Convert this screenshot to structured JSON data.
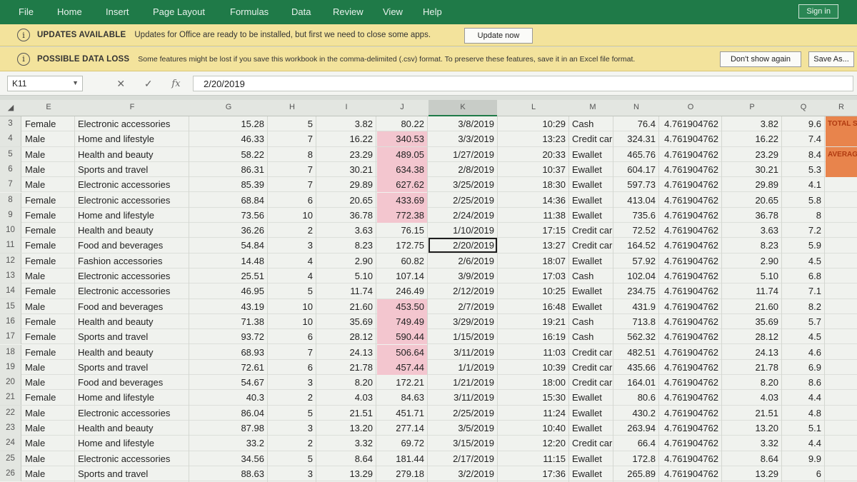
{
  "ribbon": {
    "tabs": [
      "File",
      "Home",
      "Insert",
      "Page Layout",
      "Formulas",
      "Data",
      "Review",
      "View",
      "Help"
    ],
    "signin_label": "Sign in"
  },
  "messages": {
    "updates_title": "UPDATES AVAILABLE",
    "updates_text": "Updates for Office are ready to be installed, but first we need to close some apps.",
    "update_now_label": "Update now",
    "dataloss_title": "POSSIBLE DATA LOSS",
    "dataloss_text": "Some features might be lost if you save this workbook in the comma-delimited (.csv) format. To preserve these features, save it in an Excel file format.",
    "dont_show_label": "Don't show again",
    "save_as_label": "Save As..."
  },
  "formula_bar": {
    "name_box": "K11",
    "value": "2/20/2019"
  },
  "columns": [
    "E",
    "F",
    "G",
    "H",
    "I",
    "J",
    "K",
    "L",
    "M",
    "N",
    "O",
    "P",
    "Q",
    "R"
  ],
  "rows": [
    {
      "n": "3",
      "e": "Female",
      "f": "Electronic accessories",
      "g": "15.28",
      "h": "5",
      "i": "3.82",
      "j": "80.22",
      "k": "3/8/2019",
      "l": "10:29",
      "m": "Cash",
      "nn": "76.4",
      "o": "4.761904762",
      "p": "3.82",
      "q": "9.6",
      "r": "TOTAL S"
    },
    {
      "n": "4",
      "e": "Male",
      "f": "Home and lifestyle",
      "g": "46.33",
      "h": "7",
      "i": "16.22",
      "j": "340.53",
      "k": "3/3/2019",
      "l": "13:23",
      "m": "Credit car",
      "nn": "324.31",
      "o": "4.761904762",
      "p": "16.22",
      "q": "7.4",
      "r": ""
    },
    {
      "n": "5",
      "e": "Male",
      "f": "Health and beauty",
      "g": "58.22",
      "h": "8",
      "i": "23.29",
      "j": "489.05",
      "k": "1/27/2019",
      "l": "20:33",
      "m": "Ewallet",
      "nn": "465.76",
      "o": "4.761904762",
      "p": "23.29",
      "q": "8.4",
      "r": "AVERAG"
    },
    {
      "n": "6",
      "e": "Male",
      "f": "Sports and travel",
      "g": "86.31",
      "h": "7",
      "i": "30.21",
      "j": "634.38",
      "k": "2/8/2019",
      "l": "10:37",
      "m": "Ewallet",
      "nn": "604.17",
      "o": "4.761904762",
      "p": "30.21",
      "q": "5.3",
      "r": ""
    },
    {
      "n": "7",
      "e": "Male",
      "f": "Electronic accessories",
      "g": "85.39",
      "h": "7",
      "i": "29.89",
      "j": "627.62",
      "k": "3/25/2019",
      "l": "18:30",
      "m": "Ewallet",
      "nn": "597.73",
      "o": "4.761904762",
      "p": "29.89",
      "q": "4.1",
      "r": ""
    },
    {
      "n": "8",
      "e": "Female",
      "f": "Electronic accessories",
      "g": "68.84",
      "h": "6",
      "i": "20.65",
      "j": "433.69",
      "k": "2/25/2019",
      "l": "14:36",
      "m": "Ewallet",
      "nn": "413.04",
      "o": "4.761904762",
      "p": "20.65",
      "q": "5.8",
      "r": ""
    },
    {
      "n": "9",
      "e": "Female",
      "f": "Home and lifestyle",
      "g": "73.56",
      "h": "10",
      "i": "36.78",
      "j": "772.38",
      "k": "2/24/2019",
      "l": "11:38",
      "m": "Ewallet",
      "nn": "735.6",
      "o": "4.761904762",
      "p": "36.78",
      "q": "8",
      "r": ""
    },
    {
      "n": "10",
      "e": "Female",
      "f": "Health and beauty",
      "g": "36.26",
      "h": "2",
      "i": "3.63",
      "j": "76.15",
      "k": "1/10/2019",
      "l": "17:15",
      "m": "Credit car",
      "nn": "72.52",
      "o": "4.761904762",
      "p": "3.63",
      "q": "7.2",
      "r": ""
    },
    {
      "n": "11",
      "e": "Female",
      "f": "Food and beverages",
      "g": "54.84",
      "h": "3",
      "i": "8.23",
      "j": "172.75",
      "k": "2/20/2019",
      "l": "13:27",
      "m": "Credit car",
      "nn": "164.52",
      "o": "4.761904762",
      "p": "8.23",
      "q": "5.9",
      "r": ""
    },
    {
      "n": "12",
      "e": "Female",
      "f": "Fashion accessories",
      "g": "14.48",
      "h": "4",
      "i": "2.90",
      "j": "60.82",
      "k": "2/6/2019",
      "l": "18:07",
      "m": "Ewallet",
      "nn": "57.92",
      "o": "4.761904762",
      "p": "2.90",
      "q": "4.5",
      "r": ""
    },
    {
      "n": "13",
      "e": "Male",
      "f": "Electronic accessories",
      "g": "25.51",
      "h": "4",
      "i": "5.10",
      "j": "107.14",
      "k": "3/9/2019",
      "l": "17:03",
      "m": "Cash",
      "nn": "102.04",
      "o": "4.761904762",
      "p": "5.10",
      "q": "6.8",
      "r": ""
    },
    {
      "n": "14",
      "e": "Female",
      "f": "Electronic accessories",
      "g": "46.95",
      "h": "5",
      "i": "11.74",
      "j": "246.49",
      "k": "2/12/2019",
      "l": "10:25",
      "m": "Ewallet",
      "nn": "234.75",
      "o": "4.761904762",
      "p": "11.74",
      "q": "7.1",
      "r": ""
    },
    {
      "n": "15",
      "e": "Male",
      "f": "Food and beverages",
      "g": "43.19",
      "h": "10",
      "i": "21.60",
      "j": "453.50",
      "k": "2/7/2019",
      "l": "16:48",
      "m": "Ewallet",
      "nn": "431.9",
      "o": "4.761904762",
      "p": "21.60",
      "q": "8.2",
      "r": ""
    },
    {
      "n": "16",
      "e": "Female",
      "f": "Health and beauty",
      "g": "71.38",
      "h": "10",
      "i": "35.69",
      "j": "749.49",
      "k": "3/29/2019",
      "l": "19:21",
      "m": "Cash",
      "nn": "713.8",
      "o": "4.761904762",
      "p": "35.69",
      "q": "5.7",
      "r": ""
    },
    {
      "n": "17",
      "e": "Female",
      "f": "Sports and travel",
      "g": "93.72",
      "h": "6",
      "i": "28.12",
      "j": "590.44",
      "k": "1/15/2019",
      "l": "16:19",
      "m": "Cash",
      "nn": "562.32",
      "o": "4.761904762",
      "p": "28.12",
      "q": "4.5",
      "r": ""
    },
    {
      "n": "18",
      "e": "Female",
      "f": "Health and beauty",
      "g": "68.93",
      "h": "7",
      "i": "24.13",
      "j": "506.64",
      "k": "3/11/2019",
      "l": "11:03",
      "m": "Credit car",
      "nn": "482.51",
      "o": "4.761904762",
      "p": "24.13",
      "q": "4.6",
      "r": ""
    },
    {
      "n": "19",
      "e": "Male",
      "f": "Sports and travel",
      "g": "72.61",
      "h": "6",
      "i": "21.78",
      "j": "457.44",
      "k": "1/1/2019",
      "l": "10:39",
      "m": "Credit car",
      "nn": "435.66",
      "o": "4.761904762",
      "p": "21.78",
      "q": "6.9",
      "r": ""
    },
    {
      "n": "20",
      "e": "Male",
      "f": "Food and beverages",
      "g": "54.67",
      "h": "3",
      "i": "8.20",
      "j": "172.21",
      "k": "1/21/2019",
      "l": "18:00",
      "m": "Credit car",
      "nn": "164.01",
      "o": "4.761904762",
      "p": "8.20",
      "q": "8.6",
      "r": ""
    },
    {
      "n": "21",
      "e": "Female",
      "f": "Home and lifestyle",
      "g": "40.3",
      "h": "2",
      "i": "4.03",
      "j": "84.63",
      "k": "3/11/2019",
      "l": "15:30",
      "m": "Ewallet",
      "nn": "80.6",
      "o": "4.761904762",
      "p": "4.03",
      "q": "4.4",
      "r": ""
    },
    {
      "n": "22",
      "e": "Male",
      "f": "Electronic accessories",
      "g": "86.04",
      "h": "5",
      "i": "21.51",
      "j": "451.71",
      "k": "2/25/2019",
      "l": "11:24",
      "m": "Ewallet",
      "nn": "430.2",
      "o": "4.761904762",
      "p": "21.51",
      "q": "4.8",
      "r": ""
    },
    {
      "n": "23",
      "e": "Male",
      "f": "Health and beauty",
      "g": "87.98",
      "h": "3",
      "i": "13.20",
      "j": "277.14",
      "k": "3/5/2019",
      "l": "10:40",
      "m": "Ewallet",
      "nn": "263.94",
      "o": "4.761904762",
      "p": "13.20",
      "q": "5.1",
      "r": ""
    },
    {
      "n": "24",
      "e": "Male",
      "f": "Home and lifestyle",
      "g": "33.2",
      "h": "2",
      "i": "3.32",
      "j": "69.72",
      "k": "3/15/2019",
      "l": "12:20",
      "m": "Credit car",
      "nn": "66.4",
      "o": "4.761904762",
      "p": "3.32",
      "q": "4.4",
      "r": ""
    },
    {
      "n": "25",
      "e": "Male",
      "f": "Electronic accessories",
      "g": "34.56",
      "h": "5",
      "i": "8.64",
      "j": "181.44",
      "k": "2/17/2019",
      "l": "11:15",
      "m": "Ewallet",
      "nn": "172.8",
      "o": "4.761904762",
      "p": "8.64",
      "q": "9.9",
      "r": ""
    },
    {
      "n": "26",
      "e": "Male",
      "f": "Sports and travel",
      "g": "88.63",
      "h": "3",
      "i": "13.29",
      "j": "279.18",
      "k": "3/2/2019",
      "l": "17:36",
      "m": "Ewallet",
      "nn": "265.89",
      "o": "4.761904762",
      "p": "13.29",
      "q": "6",
      "r": ""
    }
  ],
  "highlight": {
    "pink_rows_in_J": [
      "4",
      "5",
      "6",
      "7",
      "8",
      "9",
      "15",
      "16",
      "17",
      "18",
      "19"
    ],
    "selected_cell": "K11",
    "pink_color": "#f3c6cf",
    "orange_color": "#e8844c",
    "accent_color": "#1f7a48"
  }
}
